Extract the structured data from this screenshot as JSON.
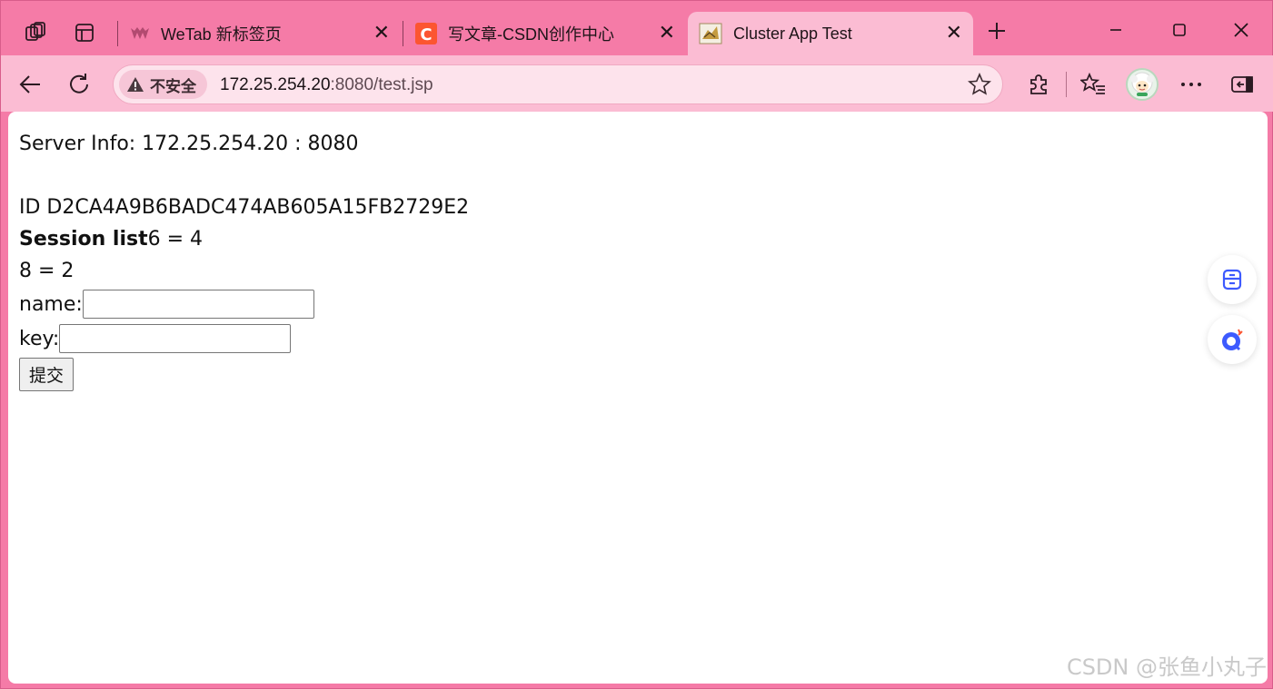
{
  "tabs": [
    {
      "title": "WeTab 新标签页",
      "icon": "wetab-logo-icon"
    },
    {
      "title": "写文章-CSDN创作中心",
      "icon": "csdn-logo-icon"
    },
    {
      "title": "Cluster App Test",
      "icon": "cluster-app-favicon-icon",
      "active": true
    }
  ],
  "omnibox": {
    "security_label": "不安全",
    "url_host": "172.25.254.20",
    "url_rest": ":8080/test.jsp"
  },
  "page": {
    "server_info": "Server Info: 172.25.254.20 : 8080",
    "session_id": "ID D2CA4A9B6BADC474AB605A15FB2729E2",
    "session_list_label": "Session list",
    "session_item_1": "6 = 4",
    "session_item_2": "8 = 2",
    "name_label": "name:",
    "name_value": "",
    "key_label": "key:",
    "key_value": "",
    "submit_label": "提交"
  },
  "watermark": "CSDN @张鱼小丸子",
  "colors": {
    "tabstrip_bg": "#f57ba7",
    "toolbar_bg": "#fbbcd3",
    "omnibox_bg": "#fde3ec",
    "csdn_red": "#fc5531",
    "float_icon_blue": "#3d5afe"
  }
}
